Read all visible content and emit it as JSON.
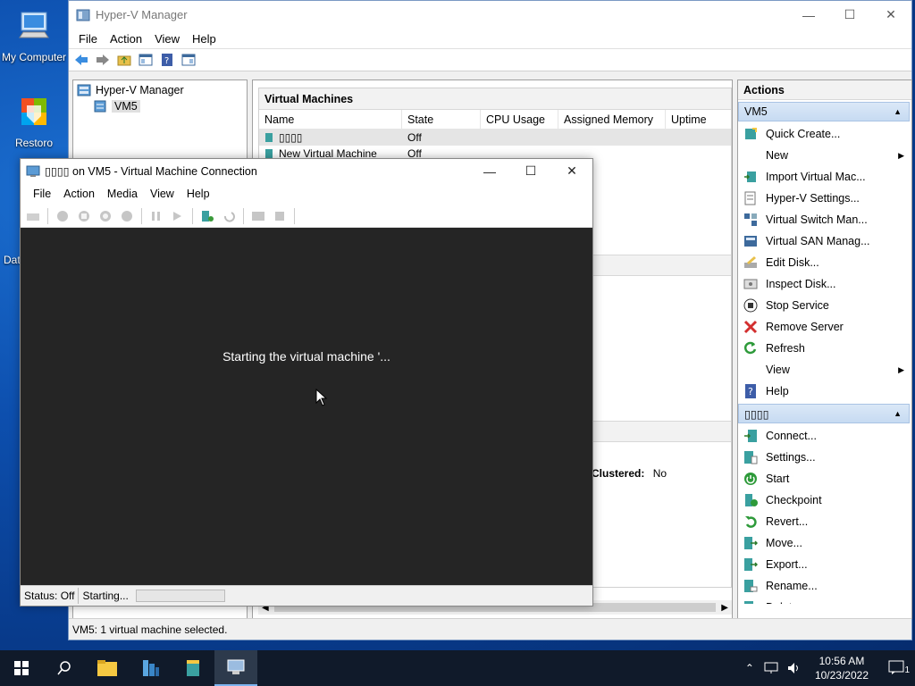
{
  "desktop": {
    "icons": [
      {
        "label": "My Computer"
      },
      {
        "label": "Restoro"
      },
      {
        "label": "Dat"
      }
    ]
  },
  "hyperv": {
    "title": "Hyper-V Manager",
    "menu": [
      "File",
      "Action",
      "View",
      "Help"
    ],
    "tree": {
      "root": "Hyper-V Manager",
      "child": "VM5"
    },
    "vm_panel": {
      "title": "Virtual Machines",
      "columns": [
        "Name",
        "State",
        "CPU Usage",
        "Assigned Memory",
        "Uptime"
      ],
      "rows": [
        {
          "name": "▯▯▯▯",
          "state": "Off"
        },
        {
          "name": "New Virtual Machine",
          "state": "Off"
        }
      ]
    },
    "details": {
      "clustered_label": "Clustered:",
      "clustered_value": "No"
    },
    "actions": {
      "title": "Actions",
      "group1": "VM5",
      "group1_items": [
        {
          "label": "Quick Create...",
          "icon": "quick-create-icon"
        },
        {
          "label": "New",
          "icon": "none",
          "submenu": true
        },
        {
          "label": "Import Virtual Mac...",
          "icon": "import-icon"
        },
        {
          "label": "Hyper-V Settings...",
          "icon": "settings-icon"
        },
        {
          "label": "Virtual Switch Man...",
          "icon": "switch-icon"
        },
        {
          "label": "Virtual SAN Manag...",
          "icon": "san-icon"
        },
        {
          "label": "Edit Disk...",
          "icon": "edit-disk-icon"
        },
        {
          "label": "Inspect Disk...",
          "icon": "inspect-disk-icon"
        },
        {
          "label": "Stop Service",
          "icon": "stop-icon"
        },
        {
          "label": "Remove Server",
          "icon": "remove-icon"
        },
        {
          "label": "Refresh",
          "icon": "refresh-icon"
        },
        {
          "label": "View",
          "icon": "none",
          "submenu": true
        },
        {
          "label": "Help",
          "icon": "help-icon"
        }
      ],
      "group2": "▯▯▯▯",
      "group2_items": [
        {
          "label": "Connect...",
          "icon": "connect-icon"
        },
        {
          "label": "Settings...",
          "icon": "vm-settings-icon"
        },
        {
          "label": "Start",
          "icon": "start-icon"
        },
        {
          "label": "Checkpoint",
          "icon": "checkpoint-icon"
        },
        {
          "label": "Revert...",
          "icon": "revert-icon"
        },
        {
          "label": "Move...",
          "icon": "move-icon"
        },
        {
          "label": "Export...",
          "icon": "export-icon"
        },
        {
          "label": "Rename...",
          "icon": "rename-icon"
        },
        {
          "label": "Delete...",
          "icon": "delete-icon"
        }
      ]
    },
    "status": "VM5:  1 virtual machine selected."
  },
  "vmconnect": {
    "title": "▯▯▯▯ on VM5 - Virtual Machine Connection",
    "menu": [
      "File",
      "Action",
      "Media",
      "View",
      "Help"
    ],
    "message": "Starting the virtual machine '...",
    "status_state": "Status: Off",
    "status_text": "Starting..."
  },
  "taskbar": {
    "time": "10:56 AM",
    "date": "10/23/2022",
    "notification_count": "1"
  },
  "colors": {
    "accent": "#0a3d91",
    "selection": "#cce4f7",
    "vm_screen": "#252525"
  }
}
